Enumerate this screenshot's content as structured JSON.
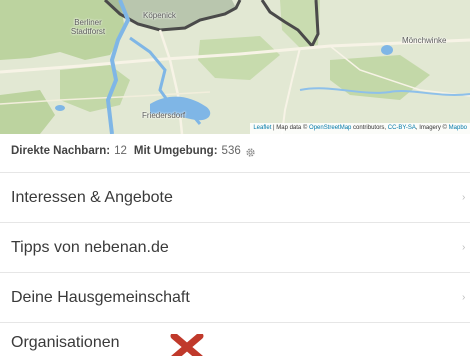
{
  "map": {
    "labels": {
      "berliner": "Berliner Stadtforst",
      "koepenick": "Köpenick",
      "friedersdorf": "Friedersdorf",
      "moenchwinkel": "Mönchwinke"
    },
    "attribution": {
      "leaflet": "Leaflet",
      "text1": " | Map data © ",
      "osm": "OpenStreetMap",
      "text2": " contributors, ",
      "license": "CC-BY-SA",
      "text3": ", Imagery © ",
      "provider": "Mapbo"
    },
    "colors": {
      "land": "#e4e9d6",
      "forest": "#b9d29a",
      "water": "#7fb6e6",
      "road": "#f4f1e4",
      "boundary": "#444444"
    }
  },
  "neighbours": {
    "direct_label": "Direkte Nachbarn:",
    "direct_value": "12",
    "area_label": "Mit Umgebung:",
    "area_value": "536",
    "settings_icon": "gear-icon"
  },
  "menu": {
    "items": [
      {
        "label": "Interessen & Angebote"
      },
      {
        "label": "Tipps von nebenan.de"
      },
      {
        "label": "Deine Hausgemeinschaft"
      },
      {
        "label": "Organisationen"
      }
    ]
  },
  "annotation": {
    "icon": "close-icon",
    "color": "#c0392b"
  }
}
